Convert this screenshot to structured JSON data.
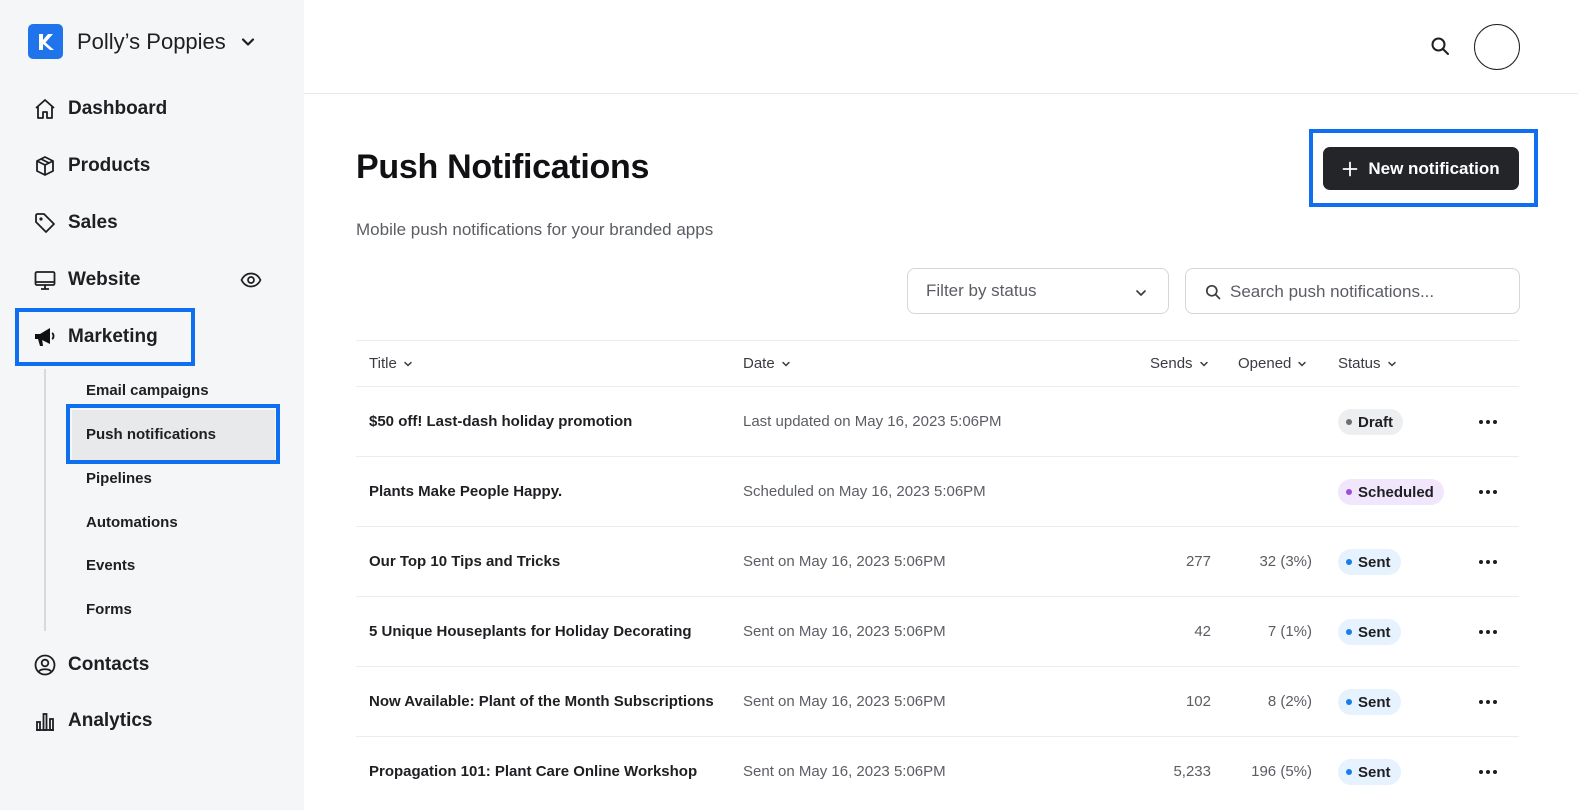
{
  "brand": {
    "name": "Polly’s Poppies"
  },
  "nav": {
    "dashboard": "Dashboard",
    "products": "Products",
    "sales": "Sales",
    "website": "Website",
    "marketing": "Marketing",
    "contacts": "Contacts",
    "analytics": "Analytics"
  },
  "marketing_sub": {
    "email": "Email campaigns",
    "push": "Push notifications",
    "pipelines": "Pipelines",
    "automations": "Automations",
    "events": "Events",
    "forms": "Forms"
  },
  "page": {
    "title": "Push Notifications",
    "subtitle": "Mobile push notifications for your branded apps",
    "new_button": "New notification"
  },
  "filter": {
    "label": "Filter by status"
  },
  "search": {
    "placeholder": "Search push notifications..."
  },
  "table": {
    "headers": {
      "title": "Title",
      "date": "Date",
      "sends": "Sends",
      "opened": "Opened",
      "status": "Status"
    },
    "rows": [
      {
        "title": "$50 off! Last-dash holiday promotion",
        "date": "Last updated on May 16, 2023 5:06PM",
        "sends": "",
        "opened": "",
        "status": "Draft"
      },
      {
        "title": "Plants Make People Happy.",
        "date": "Scheduled on May 16, 2023 5:06PM",
        "sends": "",
        "opened": "",
        "status": "Scheduled"
      },
      {
        "title": "Our Top 10 Tips and Tricks",
        "date": "Sent on May 16, 2023 5:06PM",
        "sends": "277",
        "opened": "32 (3%)",
        "status": "Sent"
      },
      {
        "title": "5 Unique Houseplants for Holiday Decorating",
        "date": "Sent on May 16, 2023 5:06PM",
        "sends": "42",
        "opened": "7 (1%)",
        "status": "Sent"
      },
      {
        "title": "Now Available: Plant of the Month Subscriptions",
        "date": "Sent on May 16, 2023 5:06PM",
        "sends": "102",
        "opened": "8 (2%)",
        "status": "Sent"
      },
      {
        "title": "Propagation 101: Plant Care Online Workshop",
        "date": "Sent on May 16, 2023 5:06PM",
        "sends": "5,233",
        "opened": "196 (5%)",
        "status": "Sent"
      }
    ]
  },
  "colors": {
    "accent": "#1f74ec",
    "highlight": "#0f6ff0",
    "draft_bg": "#eceef0",
    "draft_dot": "#6b6e73",
    "scheduled_bg": "#f1e6fb",
    "scheduled_dot": "#9b4fe0",
    "sent_bg": "#e6f2fd",
    "sent_dot": "#1a7ce6"
  }
}
